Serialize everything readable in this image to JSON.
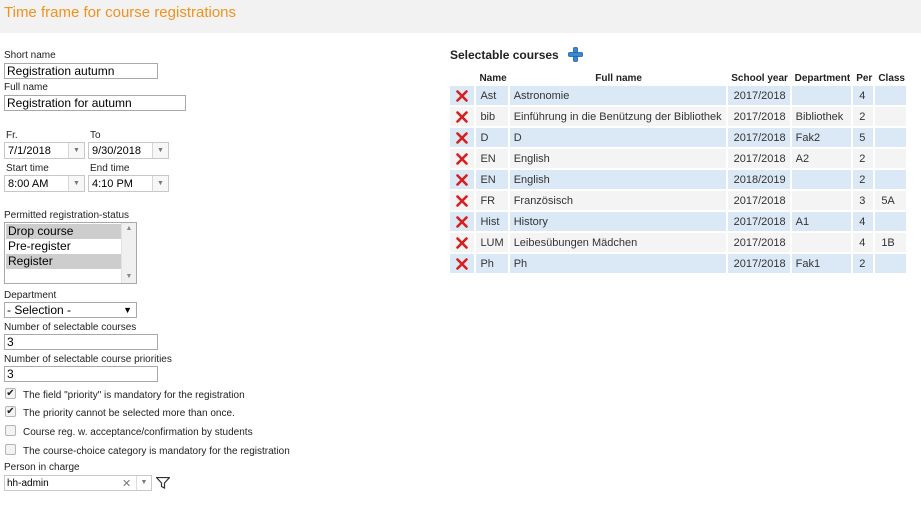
{
  "page": {
    "title": "Time frame for course registrations"
  },
  "form": {
    "short_name": {
      "label": "Short name",
      "value": "Registration autumn"
    },
    "full_name": {
      "label": "Full name",
      "value": "Registration for autumn"
    },
    "from": {
      "label": "Fr.",
      "value": "7/1/2018"
    },
    "to": {
      "label": "To",
      "value": "9/30/2018"
    },
    "start_time": {
      "label": "Start time",
      "value": "8:00 AM"
    },
    "end_time": {
      "label": "End time",
      "value": "4:10 PM"
    },
    "permitted_status": {
      "label": "Permitted registration-status",
      "options": [
        {
          "label": "Drop course",
          "selected": true
        },
        {
          "label": "Pre-register",
          "selected": false
        },
        {
          "label": "Register",
          "selected": true
        }
      ]
    },
    "department": {
      "label": "Department",
      "value": "- Selection -"
    },
    "num_courses": {
      "label": "Number of selectable courses",
      "value": "3"
    },
    "num_priorities": {
      "label": "Number of selectable course priorities",
      "value": "3"
    },
    "checkboxes": [
      {
        "label": "The field \"priority\" is mandatory for the registration",
        "checked": true
      },
      {
        "label": "The priority cannot be selected more than once.",
        "checked": true
      },
      {
        "label": "Course reg. w. acceptance/confirmation by students",
        "checked": false
      },
      {
        "label": "The course-choice category is mandatory for the registration",
        "checked": false
      }
    ],
    "person_in_charge": {
      "label": "Person in charge",
      "value": "hh-admin"
    }
  },
  "courses": {
    "title": "Selectable courses",
    "columns": [
      "Name",
      "Full name",
      "School year",
      "Department",
      "Per",
      "Class"
    ],
    "rows": [
      {
        "name": "Ast",
        "full_name": "Astronomie",
        "school_year": "2017/2018",
        "department": "",
        "per": "4",
        "class": ""
      },
      {
        "name": "bib",
        "full_name": "Einführung in die Benützung der Bibliothek",
        "school_year": "2017/2018",
        "department": "Bibliothek",
        "per": "2",
        "class": ""
      },
      {
        "name": "D",
        "full_name": "D",
        "school_year": "2017/2018",
        "department": "Fak2",
        "per": "5",
        "class": ""
      },
      {
        "name": "EN",
        "full_name": "English",
        "school_year": "2017/2018",
        "department": "A2",
        "per": "2",
        "class": ""
      },
      {
        "name": "EN",
        "full_name": "English",
        "school_year": "2018/2019",
        "department": "",
        "per": "2",
        "class": ""
      },
      {
        "name": "FR",
        "full_name": "Französisch",
        "school_year": "2017/2018",
        "department": "",
        "per": "3",
        "class": "5A"
      },
      {
        "name": "Hist",
        "full_name": "History",
        "school_year": "2017/2018",
        "department": "A1",
        "per": "4",
        "class": ""
      },
      {
        "name": "LUM",
        "full_name": "Leibesübungen Mädchen",
        "school_year": "2017/2018",
        "department": "",
        "per": "4",
        "class": "1B"
      },
      {
        "name": "Ph",
        "full_name": "Ph",
        "school_year": "2017/2018",
        "department": "Fak1",
        "per": "2",
        "class": ""
      }
    ]
  },
  "icons": {
    "delete": "delete-x-icon",
    "add": "plus-icon",
    "filter": "funnel-icon",
    "accent_orange": "#f0921e",
    "delete_red": "#d42020",
    "add_blue": "#3a86d0"
  }
}
